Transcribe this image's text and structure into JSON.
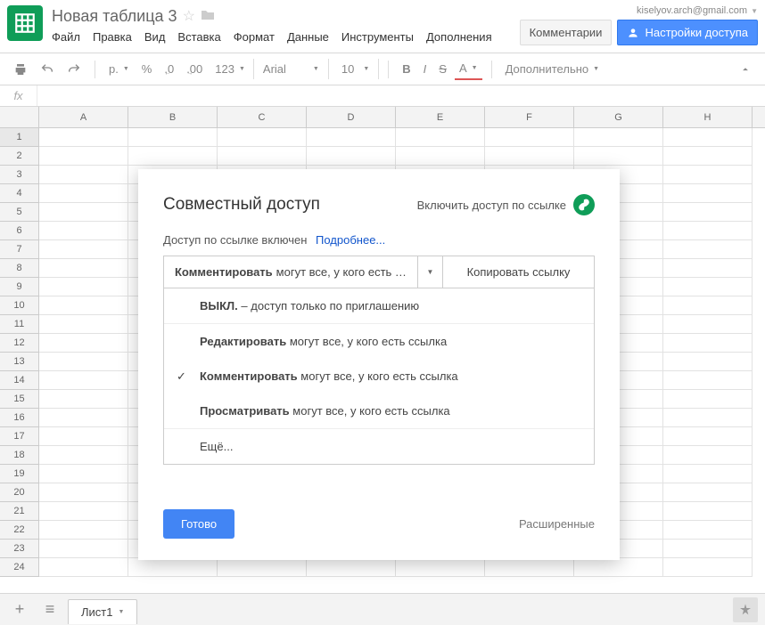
{
  "doc": {
    "title": "Новая таблица 3"
  },
  "account": "kiselyov.arch@gmail.com",
  "menubar": [
    "Файл",
    "Правка",
    "Вид",
    "Вставка",
    "Формат",
    "Данные",
    "Инструменты",
    "Дополнения"
  ],
  "header_buttons": {
    "comments": "Комментарии",
    "share": "Настройки доступа"
  },
  "toolbar": {
    "currency": "р.",
    "percent": "%",
    "dec_dec": ".0",
    "dec_inc": ".00",
    "num_fmt": "123",
    "font": "Arial",
    "size": "10",
    "bold": "B",
    "italic": "I",
    "strike": "S",
    "color": "A",
    "more": "Дополнительно"
  },
  "formula": {
    "fx": "fx"
  },
  "columns": [
    "A",
    "B",
    "C",
    "D",
    "E",
    "F",
    "G",
    "H"
  ],
  "rows": [
    1,
    2,
    3,
    4,
    5,
    6,
    7,
    8,
    9,
    10,
    11,
    12,
    13,
    14,
    15,
    16,
    17,
    18,
    19,
    20,
    21,
    22,
    23,
    24
  ],
  "sheet": {
    "name": "Лист1"
  },
  "modal": {
    "title": "Совместный доступ",
    "enable_link": "Включить доступ по ссылке",
    "status_text": "Доступ по ссылке включен",
    "learn_more": "Подробнее...",
    "selected_bold": "Комментировать",
    "selected_rest": " могут все, у кого есть с...",
    "copy": "Копировать ссылку",
    "options": {
      "off_bold": "ВЫКЛ.",
      "off_rest": " – доступ только по приглашению",
      "edit_bold": "Редактировать",
      "edit_rest": " могут все, у кого есть ссылка",
      "comment_bold": "Комментировать",
      "comment_rest": " могут все, у кого есть ссылка",
      "view_bold": "Просматривать",
      "view_rest": " могут все, у кого есть ссылка",
      "more": "Ещё..."
    },
    "done": "Готово",
    "advanced": "Расширенные"
  }
}
